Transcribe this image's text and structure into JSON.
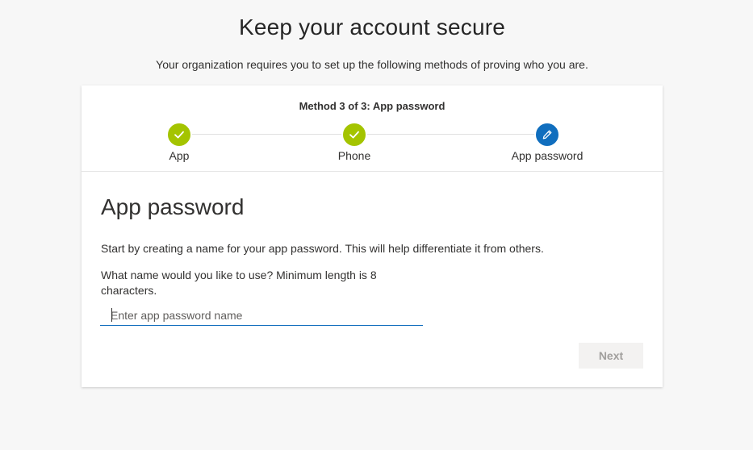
{
  "page": {
    "title": "Keep your account secure",
    "subtitle": "Your organization requires you to set up the following methods of proving who you are."
  },
  "wizard": {
    "header": "Method 3 of 3: App password",
    "steps": [
      {
        "label": "App",
        "state": "complete",
        "icon": "checkmark-icon"
      },
      {
        "label": "Phone",
        "state": "complete",
        "icon": "checkmark-icon"
      },
      {
        "label": "App password",
        "state": "current",
        "icon": "pencil-icon"
      }
    ],
    "colors": {
      "complete": "#a4c400",
      "current": "#106ebe"
    }
  },
  "form": {
    "section_title": "App password",
    "intro": "Start by creating a name for your app password. This will help differentiate it from others.",
    "question": "What name would you like to use? Minimum length is 8 characters.",
    "name_input": {
      "value": "",
      "placeholder": "Enter app password name"
    },
    "next_label": "Next"
  }
}
